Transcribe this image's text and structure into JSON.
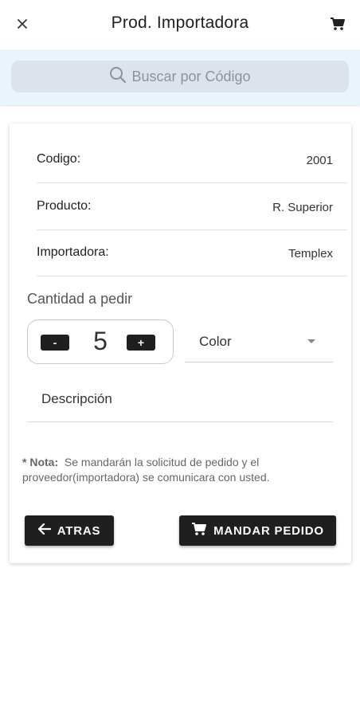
{
  "header": {
    "close_icon": "close-icon",
    "title": "Prod. Importadora",
    "cart_icon": "cart-icon"
  },
  "search": {
    "placeholder": "Buscar por Código",
    "icon": "search-icon"
  },
  "product": {
    "rows": [
      {
        "label": "Codigo:",
        "value": "2001"
      },
      {
        "label": "Producto:",
        "value": "R. Superior"
      },
      {
        "label": "Importadora:",
        "value": "Templex"
      }
    ]
  },
  "order": {
    "quantity_label": "Cantidad a pedir",
    "minus_label": "-",
    "quantity": "5",
    "plus_label": "+",
    "color_label": "Color",
    "description_placeholder": "Descripción"
  },
  "note": {
    "prefix": "* Nota:",
    "text": "Se mandarán la solicitud de pedido y el proveedor(importadora) se comunicara con usted."
  },
  "actions": {
    "back_label": "ATRAS",
    "send_label": "MANDAR PEDIDO"
  },
  "colors": {
    "header_bg": "#ffffff",
    "search_band_bg": "#eaf4fb",
    "search_box_bg": "#dde3ea",
    "button_bg": "#1f1f1f"
  }
}
